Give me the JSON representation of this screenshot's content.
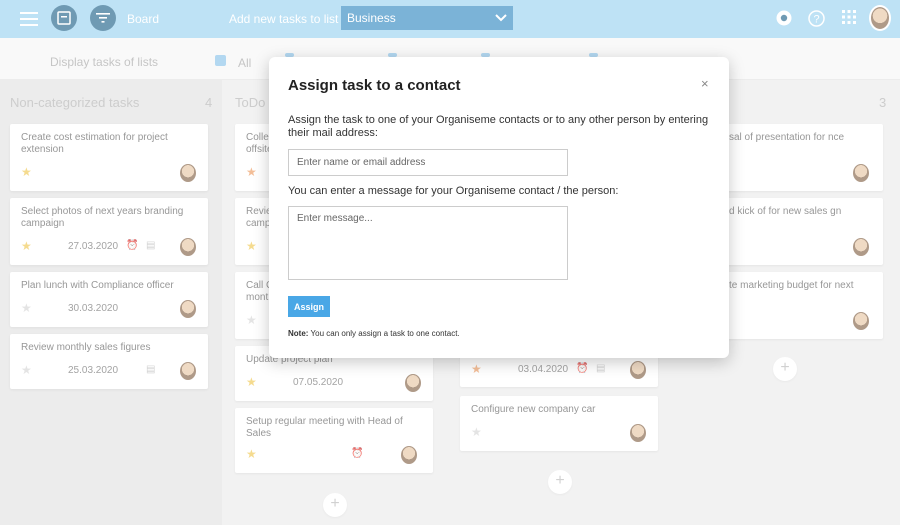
{
  "topbar": {
    "board_label": "Board",
    "add_label": "Add new tasks to list",
    "list_selected": "Business",
    "accent": "#9fd4f0"
  },
  "filterbar": {
    "label": "Display tasks of lists",
    "all_label": "All"
  },
  "columns": [
    {
      "title": "Non-categorized tasks",
      "count": "4",
      "cards": [
        {
          "title": "Create cost estimation for project extension",
          "date": ""
        },
        {
          "title": "Select photos of next years branding campaign",
          "date": "27.03.2020"
        },
        {
          "title": "Plan lunch with Compliance officer",
          "date": "30.03.2020"
        },
        {
          "title": "Review monthly sales figures",
          "date": "25.03.2020"
        }
      ]
    },
    {
      "title": "ToDo",
      "cards": [
        {
          "title": "Colle offsite"
        },
        {
          "title": "Revie camp"
        },
        {
          "title": "Call C mont"
        },
        {
          "title": "Update project plan",
          "date": "07.05.2020"
        },
        {
          "title": "Setup regular meeting with Head of Sales"
        }
      ]
    },
    {
      "cards": [
        {
          "date": "03.04.2020"
        },
        {
          "title": "Configure new company car"
        }
      ]
    },
    {
      "count": "3",
      "cards": [
        {
          "title": "sal of presentation for nce"
        },
        {
          "title": "d kick of for new sales gn"
        },
        {
          "title": "te marketing budget for next"
        }
      ]
    }
  ],
  "modal": {
    "title": "Assign task to a contact",
    "close": "×",
    "description": "Assign the task to one of your Organiseme contacts or to any other person by entering their mail address:",
    "email_placeholder": "Enter name or email address",
    "message_label": "You can enter a message for your Organiseme contact / the person:",
    "message_placeholder": "Enter message...",
    "assign_label": "Assign",
    "note_bold": "Note:",
    "note_text": " You can only assign a task to one contact."
  }
}
